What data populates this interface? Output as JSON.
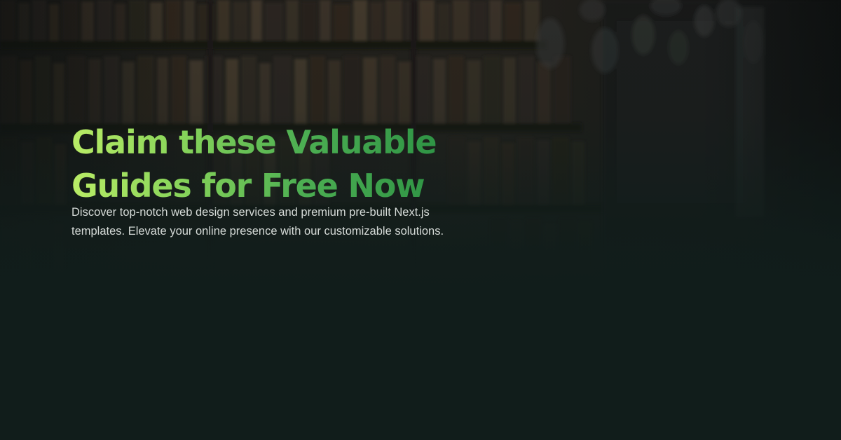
{
  "hero": {
    "headline_line1": "Claim these Valuable",
    "headline_line2": "Guides for Free Now",
    "description_line1": "Discover top-notch web design services and premium pre-built Next.js",
    "description_line2": "templates. Elevate your online presence with our customizable solutions."
  },
  "colors": {
    "background": "#111d1b",
    "headline_gradient_start": "#b9ec66",
    "headline_gradient_end": "#2f9445",
    "description_text": "#d6dbd8"
  },
  "background_image": "blurred-library-bookshelves-with-hanging-bulbs"
}
